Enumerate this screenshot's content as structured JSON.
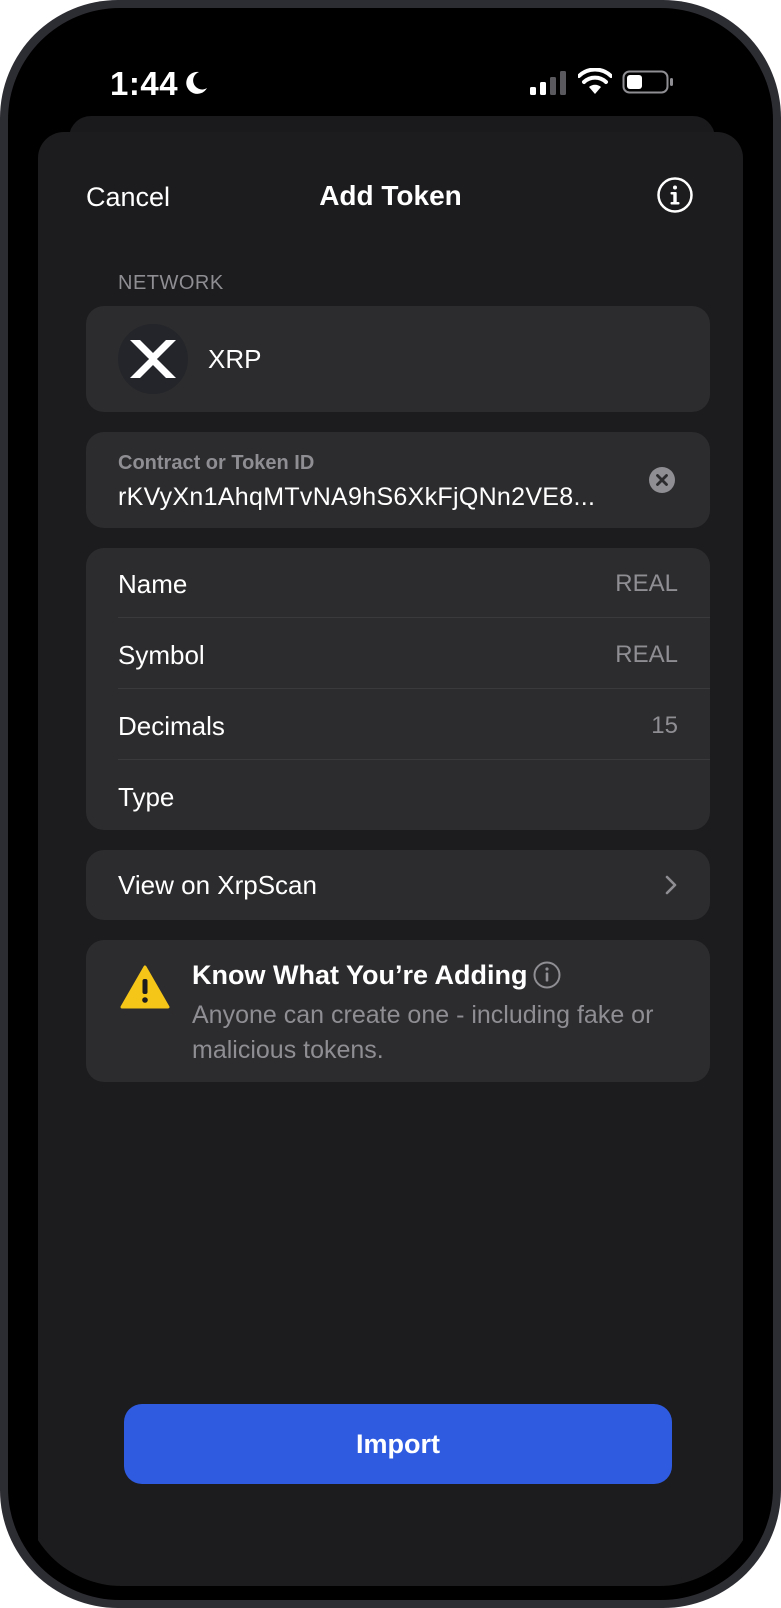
{
  "status_bar": {
    "time": "1:44",
    "icons": [
      "moon-icon",
      "signal-icon",
      "wifi-icon",
      "battery-icon"
    ]
  },
  "nav": {
    "cancel_label": "Cancel",
    "title": "Add Token",
    "info_icon": "info-icon"
  },
  "network": {
    "section_label": "NETWORK",
    "name": "XRP",
    "logo_icon": "xrp-logo-icon"
  },
  "contract": {
    "label": "Contract or Token ID",
    "value": "rKVyXn1AhqMTvNA9hS6XkFjQNn2VE8...",
    "clear_icon": "clear-icon"
  },
  "details": {
    "rows": [
      {
        "label": "Name",
        "value": "REAL"
      },
      {
        "label": "Symbol",
        "value": "REAL"
      },
      {
        "label": "Decimals",
        "value": "15"
      },
      {
        "label": "Type",
        "value": ""
      }
    ]
  },
  "view_link": {
    "label": "View on XrpScan",
    "icon": "chevron-right-icon"
  },
  "warning": {
    "title": "Know What You’re Adding",
    "body": "Anyone can create one - including fake or malicious tokens.",
    "icon": "warning-icon"
  },
  "import_button": {
    "label": "Import"
  },
  "colors": {
    "background": "#000000",
    "sheet": "#1c1c1e",
    "card": "#2c2c2e",
    "secondary_text": "#8e8e93",
    "accent": "#2f5be0",
    "warning": "#f5c518"
  }
}
